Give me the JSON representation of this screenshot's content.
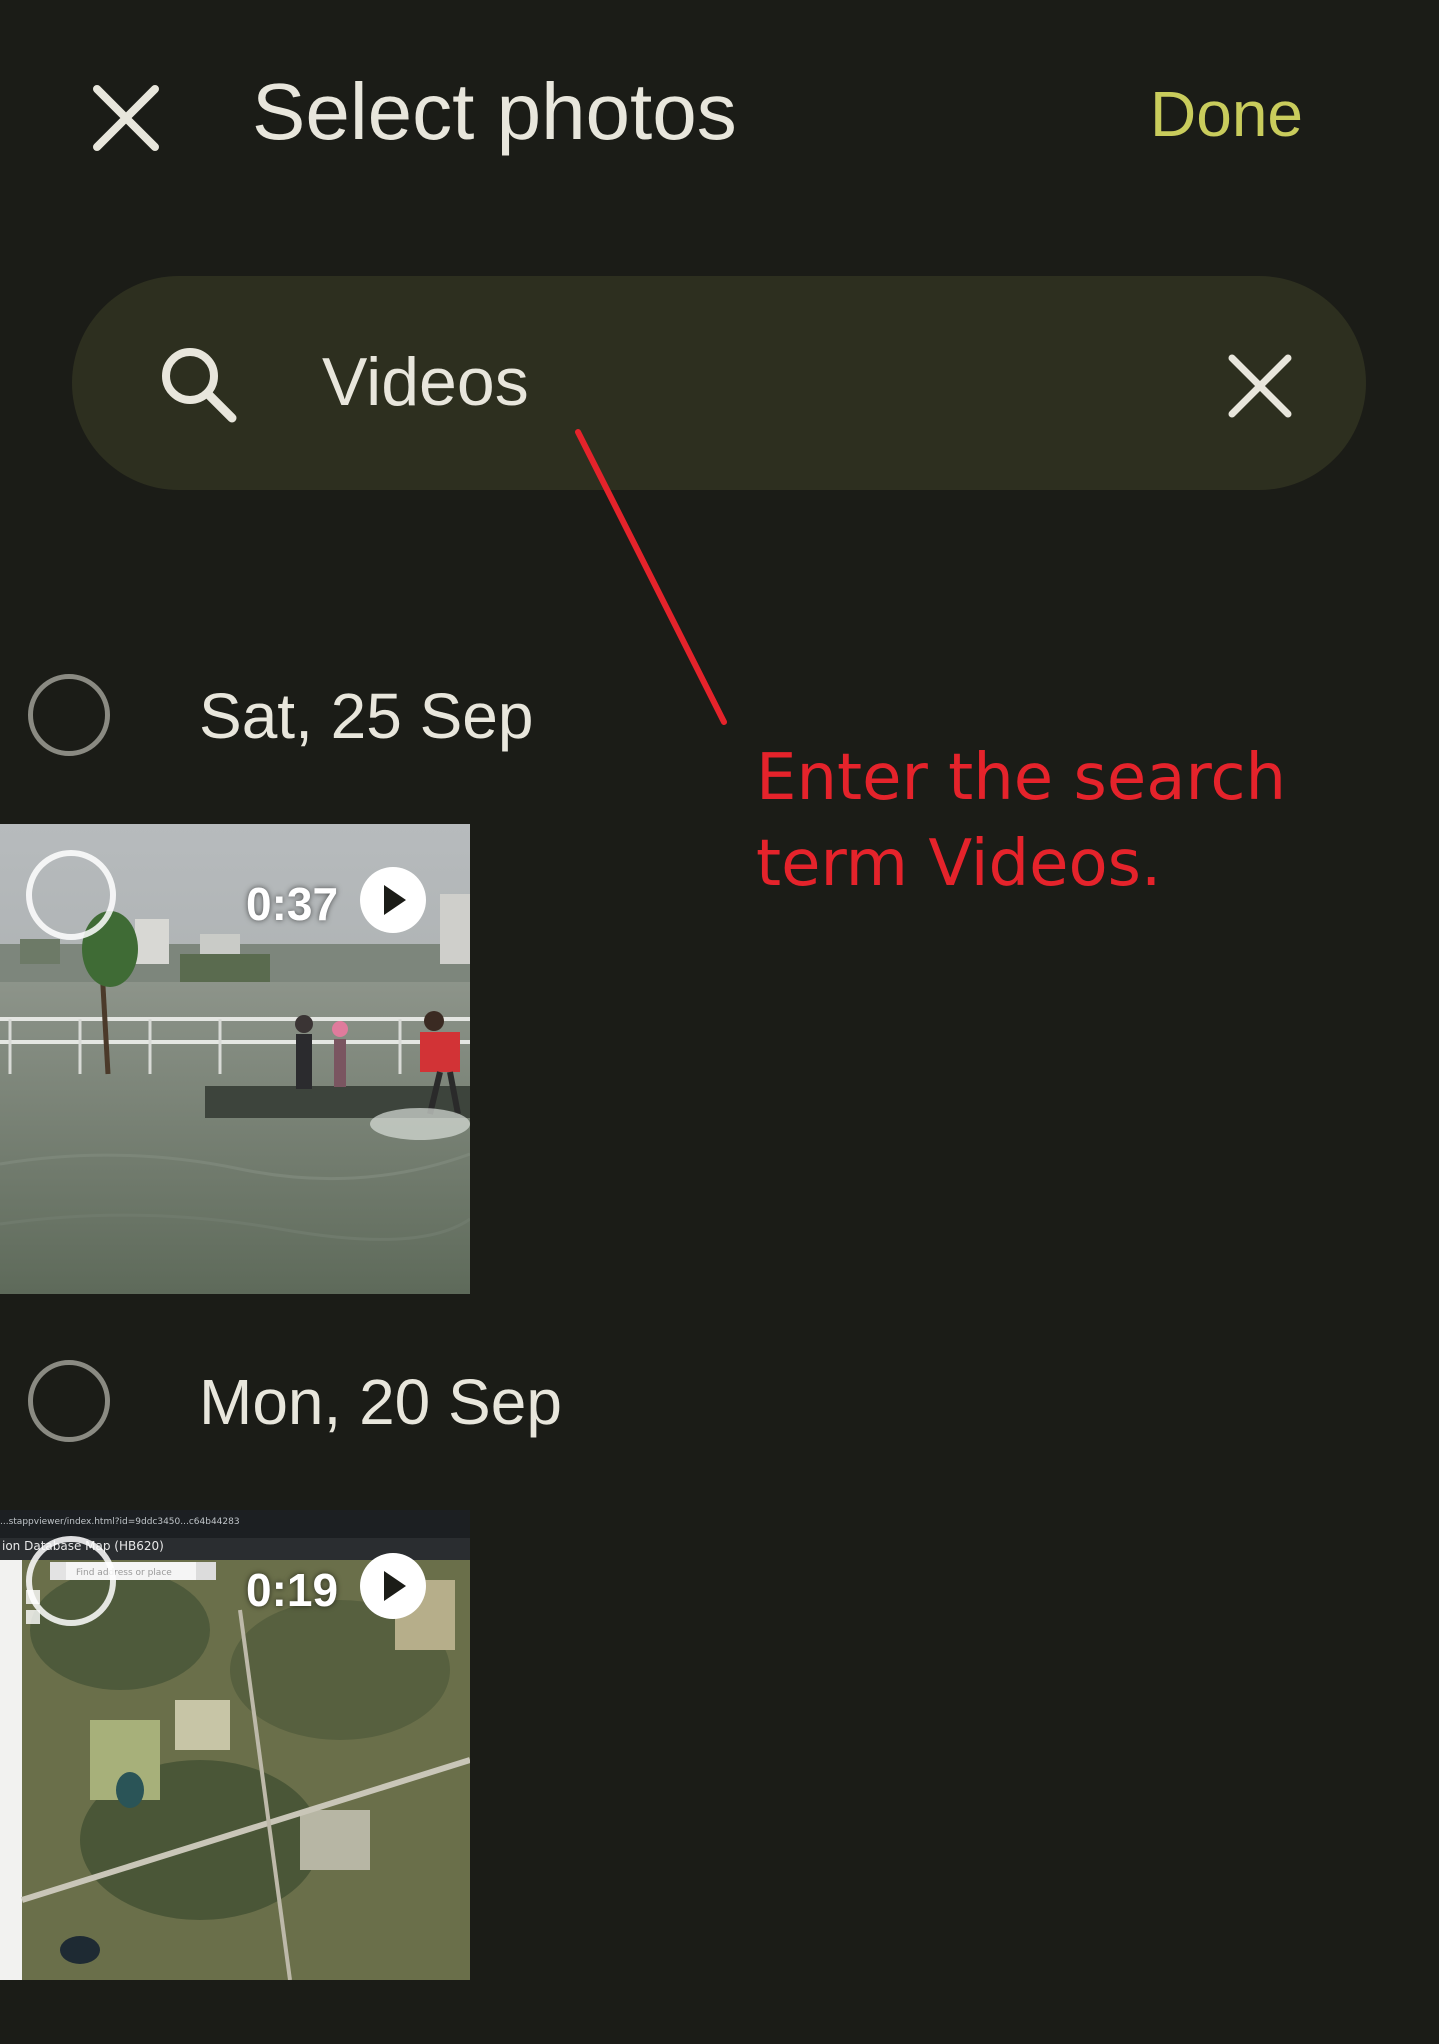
{
  "header": {
    "title": "Select photos",
    "done_label": "Done"
  },
  "search": {
    "value": "Videos"
  },
  "groups": [
    {
      "date": "Sat, 25 Sep",
      "items": [
        {
          "duration": "0:37",
          "type": "video"
        }
      ]
    },
    {
      "date": "Mon, 20 Sep",
      "items": [
        {
          "duration": "0:19",
          "type": "video",
          "screen_text": {
            "url": "...stappviewer/index.html?id=9ddc3450...c64b44283",
            "app_title": "ion Database Map (HB620)",
            "search_placeholder": "Find address or place"
          }
        }
      ]
    }
  ],
  "annotation": {
    "text_line1": "Enter the search",
    "text_line2": "term Videos."
  },
  "colors": {
    "background": "#1b1c17",
    "search_bar": "#2d2f1f",
    "done_accent": "#c9cc5c",
    "annotation": "#e5232b"
  },
  "icons": {
    "close": "close-icon",
    "search": "search-icon",
    "clear": "clear-icon",
    "play": "play-icon"
  }
}
